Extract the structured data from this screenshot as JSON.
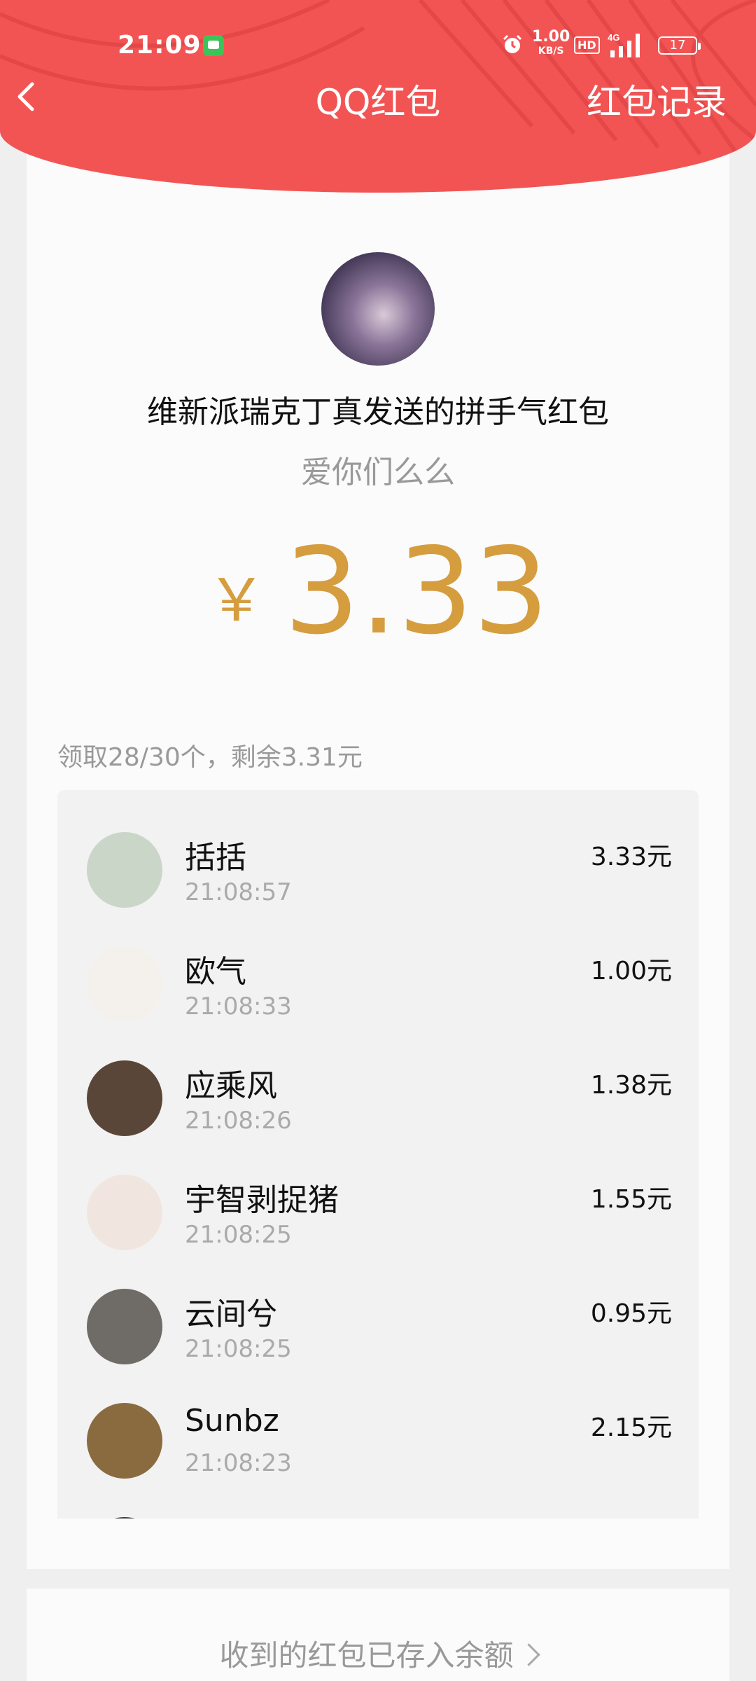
{
  "status_bar": {
    "time": "21:09",
    "net_speed_value": "1.00",
    "net_speed_unit": "KB/S",
    "hd_label": "HD",
    "network_label": "4G",
    "battery": "17"
  },
  "nav": {
    "title": "QQ红包",
    "right_link": "红包记录"
  },
  "envelope": {
    "sender_line": "维新派瑞克丁真发送的拼手气红包",
    "wish": "爱你们么么",
    "currency": "￥",
    "amount": "3.33"
  },
  "summary": "领取28/30个，剩余3.31元",
  "records": [
    {
      "name": "括括",
      "time": "21:08:57",
      "amount": "3.33元",
      "avatar_color": "#c9d6c8"
    },
    {
      "name": "欧气",
      "time": "21:08:33",
      "amount": "1.00元",
      "avatar_color": "#f4f1ec"
    },
    {
      "name": "应乘风",
      "time": "21:08:26",
      "amount": "1.38元",
      "avatar_color": "#5a4638"
    },
    {
      "name": "宇智剥捉猪",
      "time": "21:08:25",
      "amount": "1.55元",
      "avatar_color": "#f1e6df"
    },
    {
      "name": "云间兮",
      "time": "21:08:25",
      "amount": "0.95元",
      "avatar_color": "#6f6c68"
    },
    {
      "name": "Sunbz",
      "time": "21:08:23",
      "amount": "2.15元",
      "avatar_color": "#8a6b3f"
    }
  ],
  "footer": {
    "text": "收到的红包已存入余额"
  },
  "colors": {
    "header_red": "#f25454",
    "amount_gold": "#d59d3e"
  }
}
